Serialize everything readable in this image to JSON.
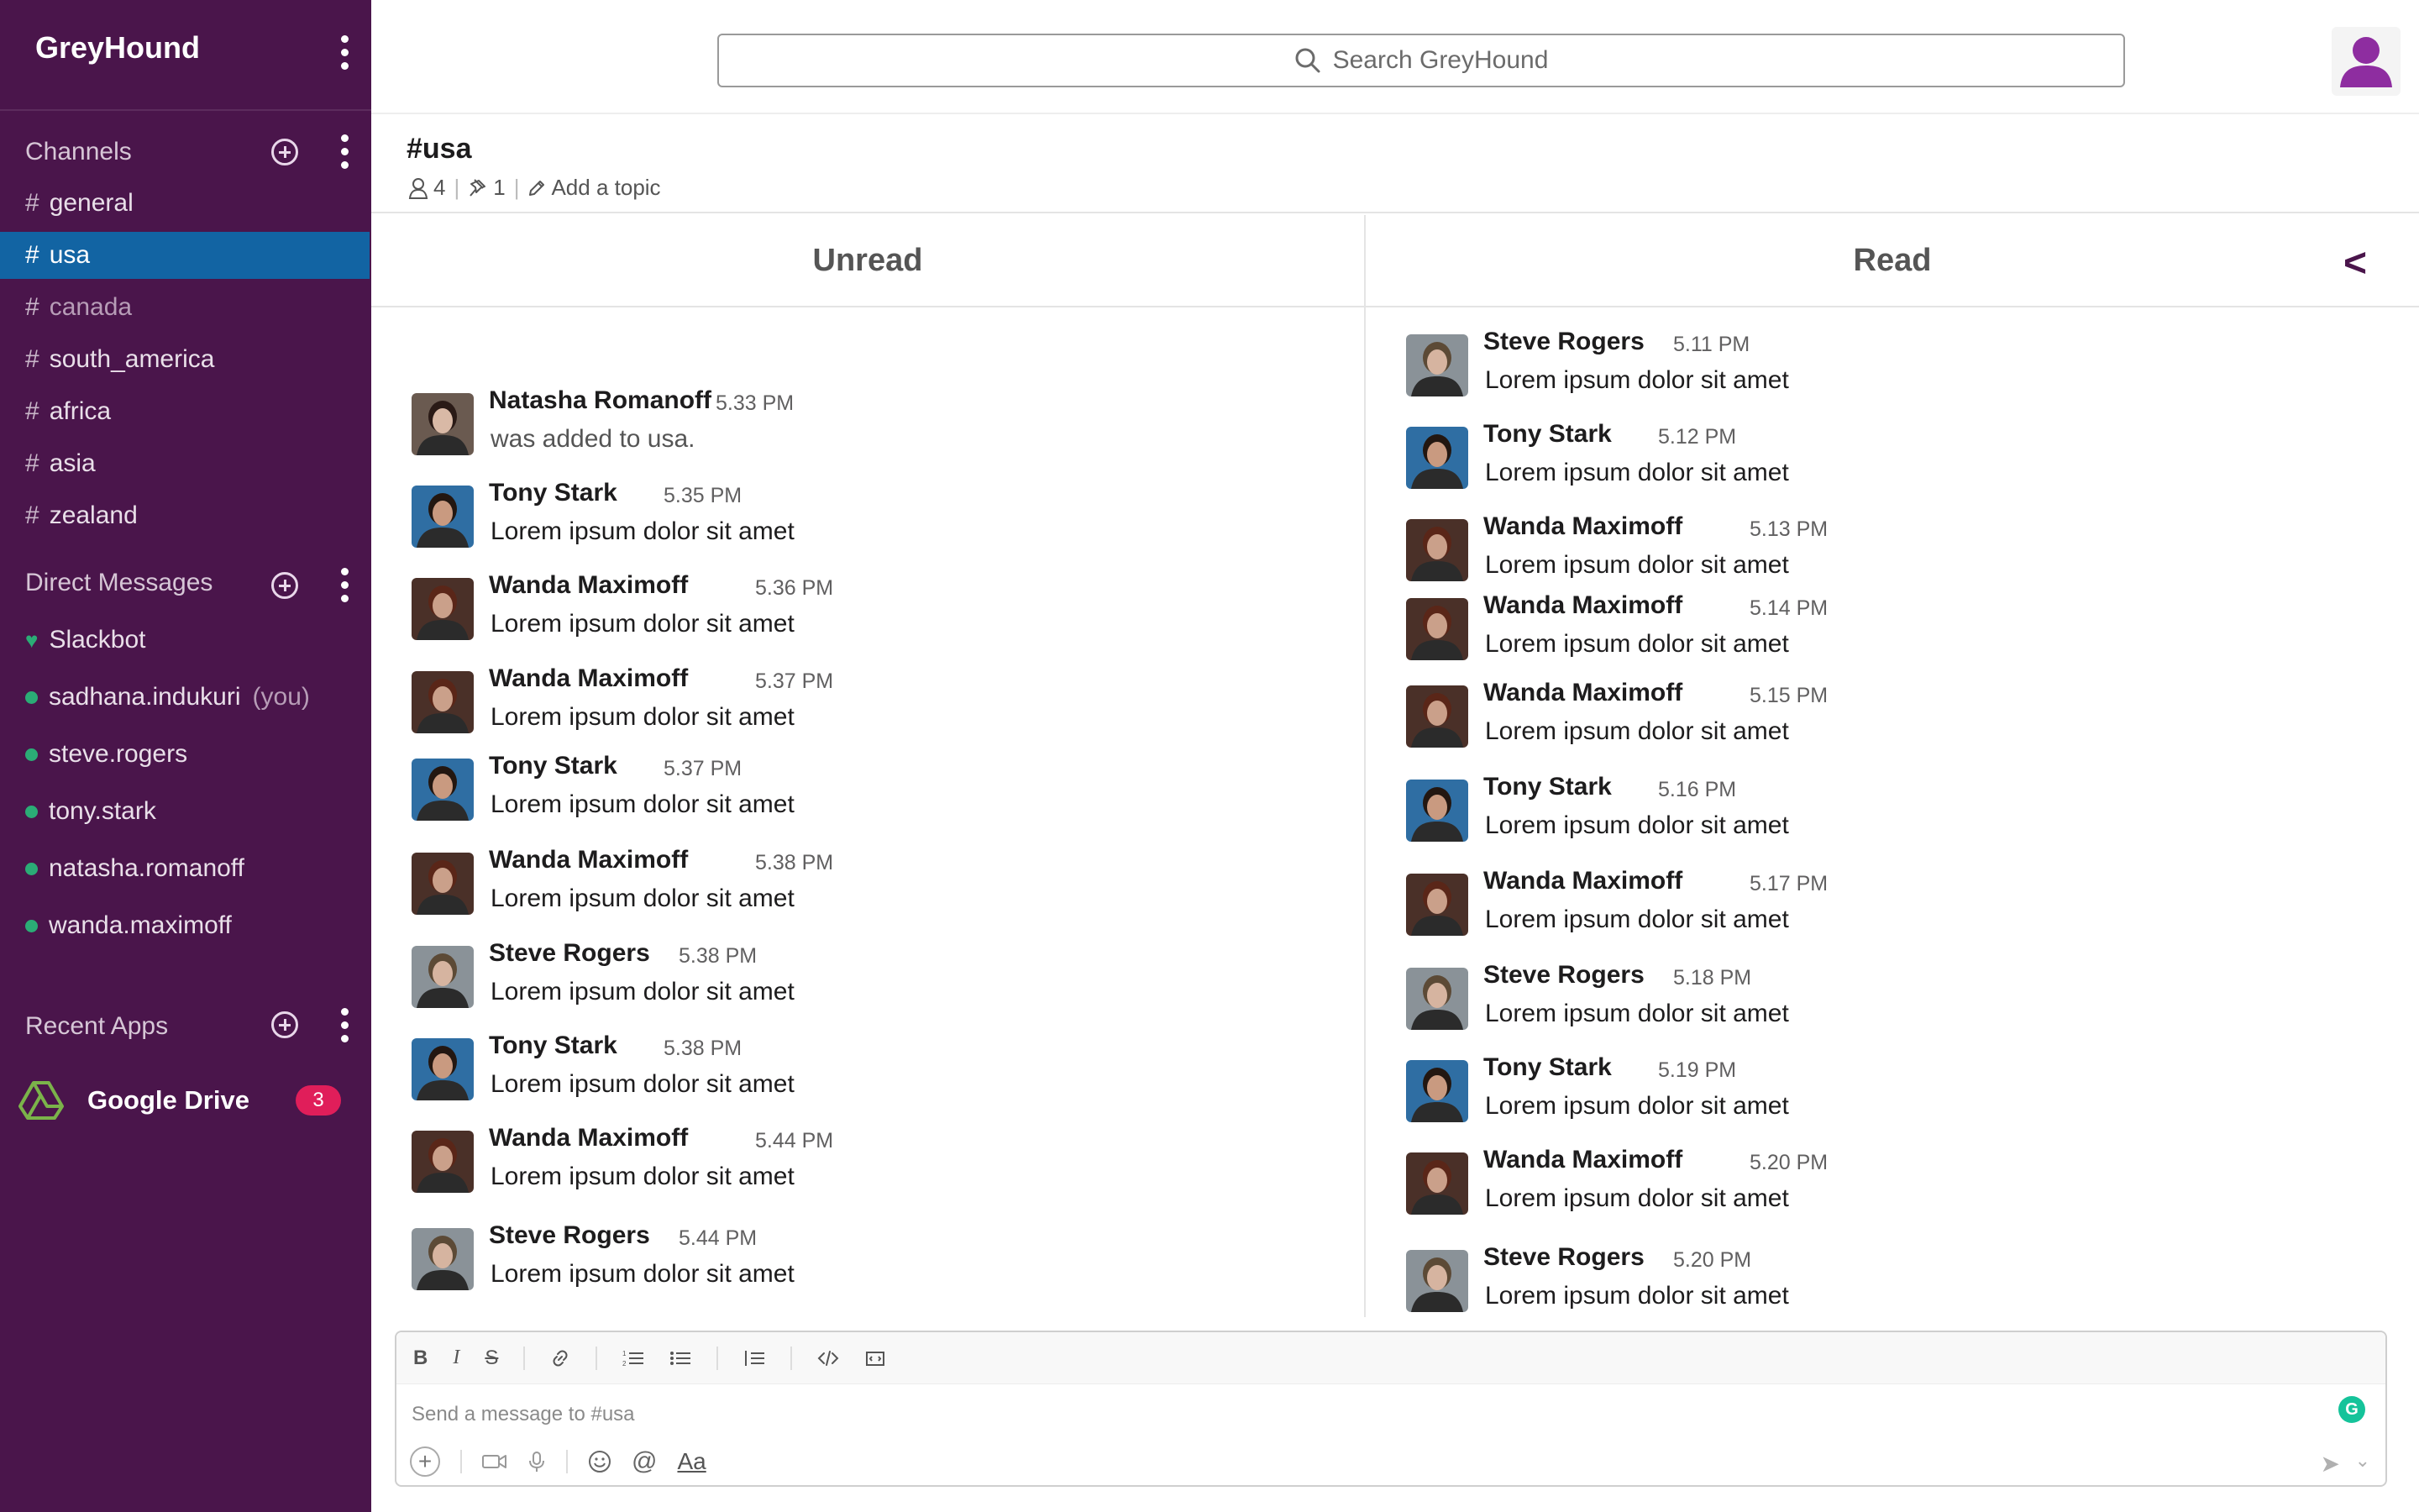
{
  "app": {
    "name": "GreyHound"
  },
  "search": {
    "placeholder": "Search GreyHound"
  },
  "sidebar": {
    "channels_title": "Channels",
    "channels": [
      {
        "name": "general",
        "state": "normal"
      },
      {
        "name": "usa",
        "state": "active"
      },
      {
        "name": "canada",
        "state": "muted"
      },
      {
        "name": "south_america",
        "state": "normal"
      },
      {
        "name": "africa",
        "state": "normal"
      },
      {
        "name": "asia",
        "state": "normal"
      },
      {
        "name": "zealand",
        "state": "normal"
      }
    ],
    "dm_title": "Direct Messages",
    "dms": [
      {
        "name": "Slackbot",
        "icon": "heart"
      },
      {
        "name": "sadhana.indukuri",
        "suffix": "(you)",
        "icon": "dot"
      },
      {
        "name": "steve.rogers",
        "icon": "dot"
      },
      {
        "name": "tony.stark",
        "icon": "dot"
      },
      {
        "name": "natasha.romanoff",
        "icon": "dot"
      },
      {
        "name": "wanda.maximoff",
        "icon": "dot"
      }
    ],
    "apps_title": "Recent Apps",
    "apps": [
      {
        "name": "Google Drive",
        "badge": "3"
      }
    ]
  },
  "channel": {
    "name": "#usa",
    "members": "4",
    "pins": "1",
    "topic_link": "Add a topic"
  },
  "panels": {
    "unread_title": "Unread",
    "read_title": "Read",
    "collapse_glyph": "<"
  },
  "unread_messages": [
    {
      "author": "Natasha Romanoff",
      "time": "5.33 PM",
      "text": "was added to usa.",
      "system": true
    },
    {
      "author": "Tony Stark",
      "time": "5.35 PM",
      "text": "Lorem ipsum dolor sit amet"
    },
    {
      "author": "Wanda Maximoff",
      "time": "5.36 PM",
      "text": "Lorem ipsum dolor sit amet"
    },
    {
      "author": "Wanda Maximoff",
      "time": "5.37 PM",
      "text": "Lorem ipsum dolor sit amet"
    },
    {
      "author": "Tony Stark",
      "time": "5.37 PM",
      "text": "Lorem ipsum dolor sit amet"
    },
    {
      "author": "Wanda Maximoff",
      "time": "5.38 PM",
      "text": "Lorem ipsum dolor sit amet"
    },
    {
      "author": "Steve Rogers",
      "time": "5.38 PM",
      "text": "Lorem ipsum dolor sit amet"
    },
    {
      "author": "Tony Stark",
      "time": "5.38 PM",
      "text": "Lorem ipsum dolor sit amet"
    },
    {
      "author": "Wanda Maximoff",
      "time": "5.44 PM",
      "text": "Lorem ipsum dolor sit amet"
    },
    {
      "author": "Steve Rogers",
      "time": "5.44 PM",
      "text": "Lorem ipsum dolor sit amet"
    }
  ],
  "read_messages": [
    {
      "author": "Steve Rogers",
      "time": "5.11 PM",
      "text": "Lorem ipsum dolor sit amet"
    },
    {
      "author": "Tony Stark",
      "time": "5.12 PM",
      "text": "Lorem ipsum dolor sit amet"
    },
    {
      "author": "Wanda Maximoff",
      "time": "5.13 PM",
      "text": "Lorem ipsum dolor sit amet"
    },
    {
      "author": "Wanda Maximoff",
      "time": "5.14 PM",
      "text": "Lorem ipsum dolor sit amet"
    },
    {
      "author": "Wanda Maximoff",
      "time": "5.15 PM",
      "text": "Lorem ipsum dolor sit amet"
    },
    {
      "author": "Tony Stark",
      "time": "5.16 PM",
      "text": "Lorem ipsum dolor sit amet"
    },
    {
      "author": "Wanda Maximoff",
      "time": "5.17 PM",
      "text": "Lorem ipsum dolor sit amet"
    },
    {
      "author": "Steve Rogers",
      "time": "5.18 PM",
      "text": "Lorem ipsum dolor sit amet"
    },
    {
      "author": "Tony Stark",
      "time": "5.19 PM",
      "text": "Lorem ipsum dolor sit amet"
    },
    {
      "author": "Wanda Maximoff",
      "time": "5.20 PM",
      "text": "Lorem ipsum dolor sit amet"
    },
    {
      "author": "Steve Rogers",
      "time": "5.20 PM",
      "text": "Lorem ipsum dolor sit amet"
    }
  ],
  "composer": {
    "placeholder": "Send a message to #usa",
    "format_tools": [
      "bold-icon",
      "italic-icon",
      "strikethrough-icon",
      "link-icon",
      "ordered-list-icon",
      "bulleted-list-icon",
      "blockquote-icon",
      "code-icon",
      "code-block-icon"
    ],
    "aa_label": "Aa",
    "grammarly_label": "G"
  },
  "colors": {
    "sidebar_bg": "#4a154b",
    "active_channel": "#1264a3",
    "presence": "#2bac76",
    "badge": "#e01e5a"
  }
}
